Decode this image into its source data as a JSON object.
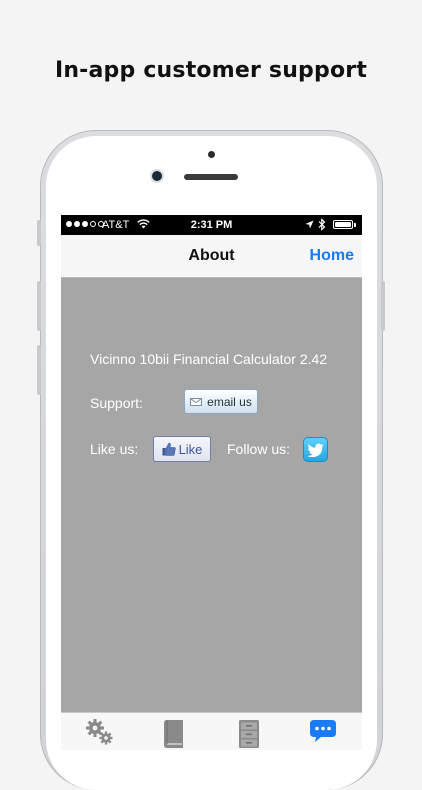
{
  "promo": {
    "headline": "In-app customer support"
  },
  "status_bar": {
    "signal_dots_filled": 3,
    "signal_dots_total": 5,
    "carrier": "AT&T",
    "time": "2:31 PM",
    "battery_level": 1.0
  },
  "nav": {
    "title": "About",
    "home_label": "Home"
  },
  "about": {
    "app_name_version": "Vicinno 10bii Financial Calculator 2.42",
    "support_label": "Support:",
    "email_button_label": "email us",
    "like_label": "Like us:",
    "like_button_label": "Like",
    "follow_label": "Follow us:"
  },
  "tabs": [
    {
      "icon": "gears-icon",
      "active": false
    },
    {
      "icon": "book-icon",
      "active": false
    },
    {
      "icon": "cabinet-icon",
      "active": false
    },
    {
      "icon": "chat-bubble-icon",
      "active": true
    }
  ],
  "colors": {
    "accent": "#1a7cf5",
    "content_background": "#a6a6a6",
    "twitter": "#2fb1e8",
    "facebook": "#3b5998"
  }
}
